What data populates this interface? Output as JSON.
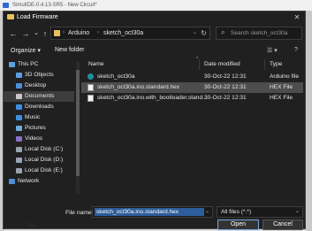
{
  "app": {
    "title": "SimulIDE-0.4.13-SR5 - New Circuit*"
  },
  "dialog": {
    "title": "Load Firmware",
    "close_glyph": "✕"
  },
  "nav": {
    "back_glyph": "←",
    "forward_glyph": "→",
    "recent_glyph": "⌄",
    "up_glyph": "↑"
  },
  "address": {
    "crumbs": [
      "Arduino",
      "sketch_oct30a"
    ],
    "separator": "›",
    "dropdown_glyph": "⌄",
    "refresh_glyph": "↻"
  },
  "search": {
    "placeholder": "Search sketch_oct30a"
  },
  "toolbar": {
    "organize": "Organize ▾",
    "new_folder": "New folder",
    "view_glyph": "☰ ▾",
    "help_glyph": "?"
  },
  "sidebar": {
    "items": [
      {
        "label": "This PC",
        "icon": "computer-icon",
        "color": "#5aa0e6"
      },
      {
        "label": "3D Objects",
        "icon": "cube-icon",
        "color": "#5aa0e6"
      },
      {
        "label": "Desktop",
        "icon": "desktop-icon",
        "color": "#4f8fd8"
      },
      {
        "label": "Documents",
        "icon": "documents-icon",
        "color": "#c8c8c8"
      },
      {
        "label": "Downloads",
        "icon": "download-icon",
        "color": "#3c8ee0"
      },
      {
        "label": "Music",
        "icon": "music-icon",
        "color": "#3c8ee0"
      },
      {
        "label": "Pictures",
        "icon": "pictures-icon",
        "color": "#6aaee0"
      },
      {
        "label": "Videos",
        "icon": "videos-icon",
        "color": "#8a70c8"
      },
      {
        "label": "Local Disk (C:)",
        "icon": "drive-icon",
        "color": "#9aa4b0"
      },
      {
        "label": "Local Disk (D:)",
        "icon": "drive-icon",
        "color": "#9aa4b0"
      },
      {
        "label": "Local Disk (E:)",
        "icon": "drive-icon",
        "color": "#9aa4b0"
      },
      {
        "label": "Network",
        "icon": "network-icon",
        "color": "#4f8fd8"
      }
    ],
    "selected": "Documents"
  },
  "columns": {
    "name": "Name",
    "date": "Date modified",
    "type": "Type",
    "sort_glyph": "^"
  },
  "files": [
    {
      "name": "sketch_oct30a",
      "date": "30-Oct-22 12:31",
      "type": "Arduino file",
      "icon": "arduino-file-icon"
    },
    {
      "name": "sketch_oct30a.ino.standard.hex",
      "date": "30-Oct-22 12:31",
      "type": "HEX File",
      "icon": "hex-file-icon"
    },
    {
      "name": "sketch_oct30a.ino.with_bootloader.stand...",
      "date": "30-Oct-22 12:31",
      "type": "HEX File",
      "icon": "hex-file-icon"
    }
  ],
  "selected_file": "sketch_oct30a.ino.standard.hex",
  "footer": {
    "file_name_label": "File name:",
    "file_name_value": "sketch_oct30a.ino.standard.hex",
    "filter_value": "All files (*.*)",
    "dropdown_glyph": "⌄",
    "open_label": "Open",
    "cancel_label": "Cancel"
  },
  "background": {
    "bottom_label": "Ard..."
  },
  "colors": {
    "accent": "#7aa8e0",
    "dialog_bg": "#202020",
    "selection": "#4d4d4d"
  }
}
